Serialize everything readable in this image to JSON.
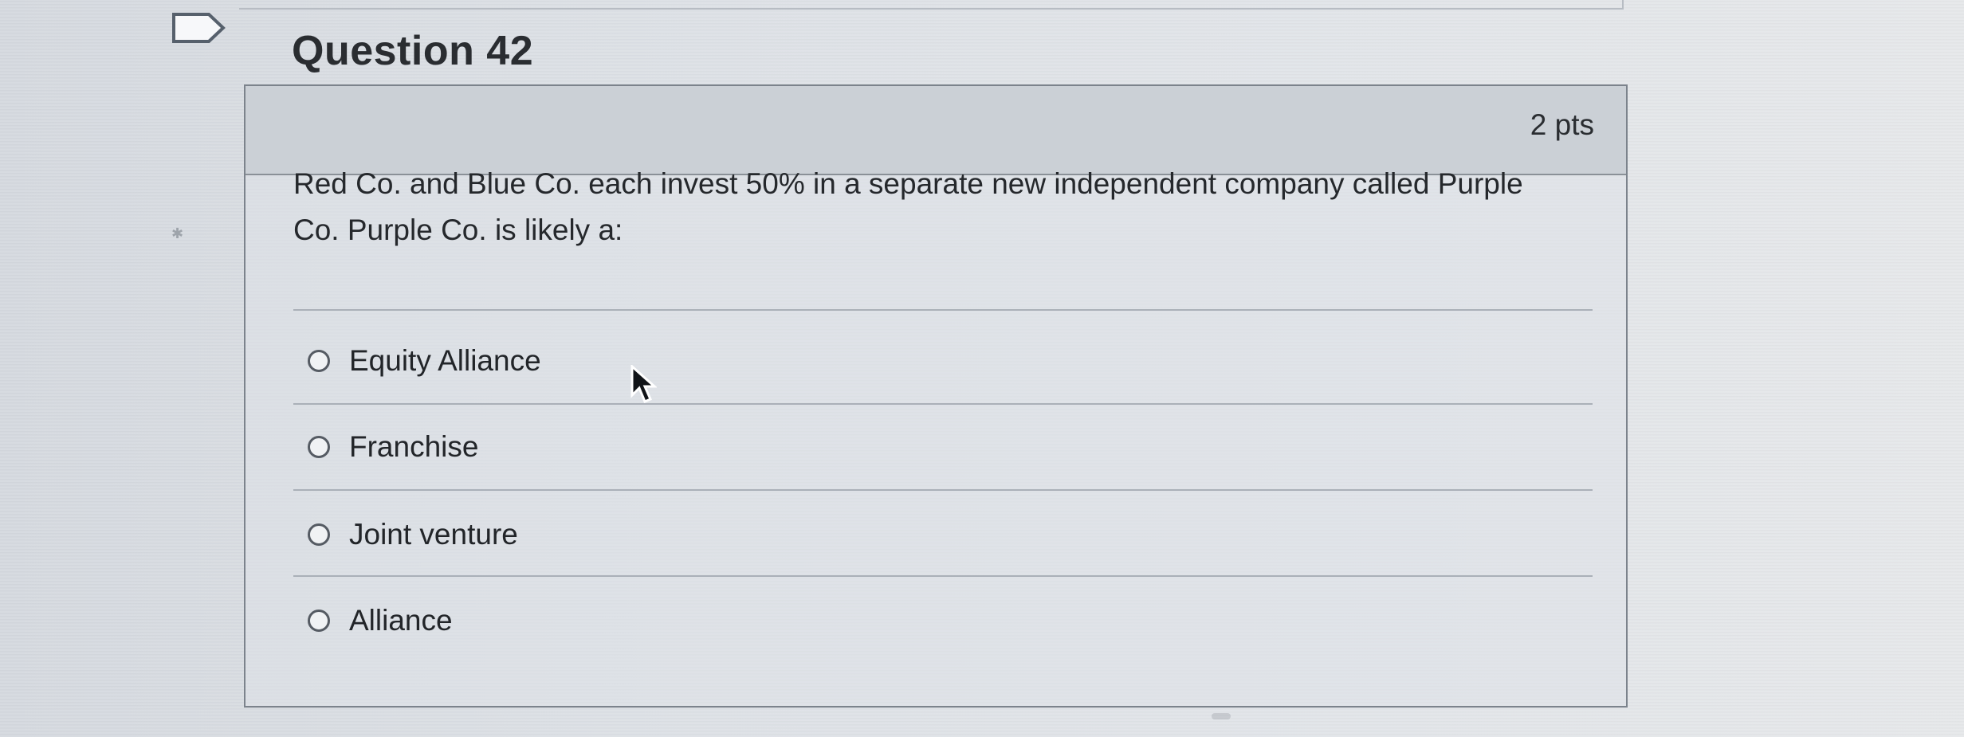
{
  "question": {
    "title": "Question 42",
    "points": "2 pts",
    "prompt": "Red Co. and Blue Co. each invest 50% in a separate new independent company called Purple Co. Purple Co. is likely a:"
  },
  "options": [
    {
      "label": "Equity Alliance"
    },
    {
      "label": "Franchise"
    },
    {
      "label": "Joint venture"
    },
    {
      "label": "Alliance"
    }
  ],
  "icons": {
    "bookmark": "bookmark-flag-icon",
    "cursor": "mouse-pointer-icon",
    "radio": "radio-button-icon"
  },
  "colors": {
    "header_background": "#cbd0d6",
    "card_border": "#7c838c",
    "text": "#2b2e33"
  }
}
